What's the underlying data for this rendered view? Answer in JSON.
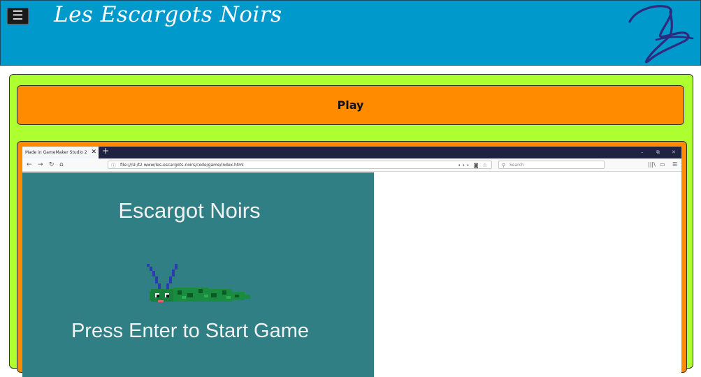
{
  "header": {
    "menu_icon": "☰",
    "site_title": "Les Escargots Noirs",
    "logo_icon": "handwritten-logo"
  },
  "main": {
    "play_label": "Play"
  },
  "browser": {
    "tab_title": "Made in GameMaker Studio 2",
    "tab_close": "✕",
    "new_tab": "+",
    "window_controls": {
      "minimize": "–",
      "restore": "⧉",
      "close": "✕"
    },
    "nav": {
      "back": "←",
      "forward": "→",
      "reload": "↻",
      "home": "⌂"
    },
    "url": "file:///U:/t2 www/les-escargots-noirs/code/game/index.html",
    "url_info_icon": "ⓘ",
    "url_actions": "••• ◙ ☆",
    "search_placeholder": "Search",
    "search_icon": "⚲",
    "tools": {
      "library": "|||\\",
      "sidebar": "▭",
      "menu": "☰"
    }
  },
  "game": {
    "title": "Escargot Noirs",
    "prompt": "Press Enter to Start Game"
  },
  "colors": {
    "header_bg": "#0099cc",
    "panel_green": "#adff2f",
    "accent_orange": "#ff8c00",
    "game_bg": "#2f7f85"
  }
}
